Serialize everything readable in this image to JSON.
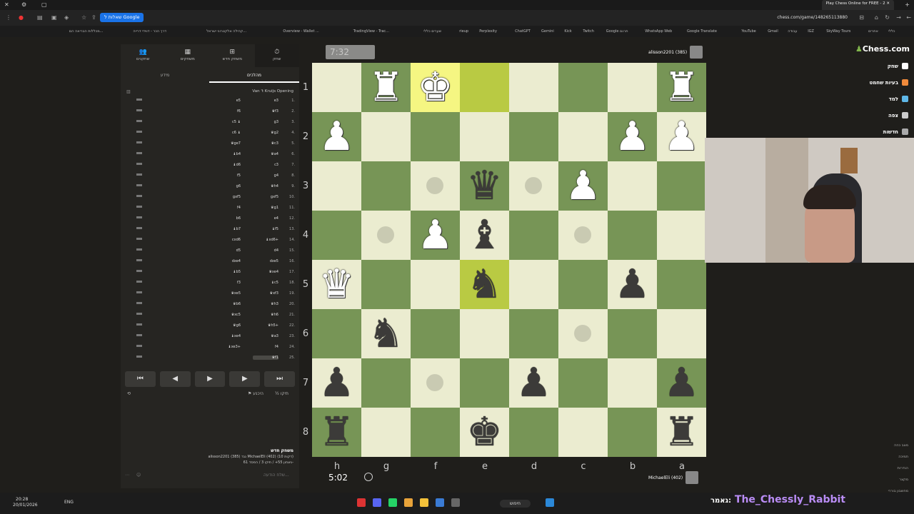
{
  "browser": {
    "tab_title": "Play Chess Online for FREE - 2",
    "google_chip": "שאלות ל Google",
    "url": "chess.com/game/148265113880"
  },
  "bookmarks": [
    "כללי",
    "אתרים",
    "SkyWay Tours",
    "IGZ",
    "עבודה",
    "Gmail",
    "YouTube",
    "Google Translate",
    "WhatsApp Web",
    "Google תרגם",
    "Twitch",
    "Kick",
    "Gemini",
    "ChatGPT",
    "Perplexity",
    "rieup",
    "שערים כללי",
    "TradingView - Trac...",
    "Overview - Wallet ...",
    "קהילה אלקטרוני ישראל...",
    "דרך הכר - דווידי דרייה",
    "מכללות הבריאה הם..."
  ],
  "right_nav": {
    "logo": "Chess",
    "logo_suffix": ".com",
    "items": [
      {
        "label": "שחק",
        "color": "#ffffff"
      },
      {
        "label": "בעיות שחמט",
        "color": "#f08a3b"
      },
      {
        "label": "למד",
        "color": "#5fb8e8"
      },
      {
        "label": "צפה",
        "color": "#cccccc"
      },
      {
        "label": "חדשות",
        "color": "#aaaaaa"
      }
    ],
    "bottom": [
      "מצב כהה",
      "תמיכה",
      "הגדרות",
      "מקצר",
      "מחשבון בוררי"
    ]
  },
  "panel": {
    "tabs": [
      {
        "label": "שחק",
        "icon": "⏱"
      },
      {
        "label": "משחק חדש",
        "icon": "⊞"
      },
      {
        "label": "משחקים",
        "icon": "▦"
      },
      {
        "label": "שחקנים",
        "icon": "👥"
      }
    ],
    "sub_tab_active": "מהלכים",
    "sub_tab_other": "מידע",
    "opening": "Van 't Kruijs Opening",
    "moves": [
      {
        "n": "1.",
        "w": "e3",
        "b": "e5"
      },
      {
        "n": "2.",
        "w": "♛f3",
        "b": "f6"
      },
      {
        "n": "3.",
        "w": "g3",
        "b": "c5 ♝"
      },
      {
        "n": "4.",
        "w": "♛g2",
        "b": "c6 ♝"
      },
      {
        "n": "5.",
        "w": "♛c3",
        "b": "♛ge7"
      },
      {
        "n": "6.",
        "w": "♛a4",
        "b": "♝b4"
      },
      {
        "n": "7.",
        "w": "c3",
        "b": "♝d6"
      },
      {
        "n": "8.",
        "w": "g4",
        "b": "f5"
      },
      {
        "n": "9.",
        "w": "♛h4",
        "b": "g6"
      },
      {
        "n": "10.",
        "w": "gxf5",
        "b": "gxf5"
      },
      {
        "n": "11.",
        "w": "♛g1",
        "b": "f4"
      },
      {
        "n": "12.",
        "w": "e4",
        "b": "b6"
      },
      {
        "n": "13.",
        "w": "♝f5",
        "b": "♝b7"
      },
      {
        "n": "14.",
        "w": "♝xd6+",
        "b": "cxd6"
      },
      {
        "n": "15.",
        "w": "d4",
        "b": "d5"
      },
      {
        "n": "16.",
        "w": "dxe5",
        "b": "dxe4"
      },
      {
        "n": "17.",
        "w": "♛xe4",
        "b": "♝b5"
      },
      {
        "n": "18.",
        "w": "♝c5",
        "b": "f3"
      },
      {
        "n": "19.",
        "w": "♛xf3",
        "b": "♛xe5"
      },
      {
        "n": "20.",
        "w": "♛h3",
        "b": "♛b6"
      },
      {
        "n": "21.",
        "w": "♛h6",
        "b": "♛xc5"
      },
      {
        "n": "22.",
        "w": "♛h5+",
        "b": "♛g6"
      },
      {
        "n": "23.",
        "w": "♛a3",
        "b": "♝xe4"
      },
      {
        "n": "24.",
        "w": "f4",
        "b": "♝xe3+"
      },
      {
        "n": "25.",
        "w": "♛f1",
        "b": ""
      }
    ],
    "controls": [
      "⏮",
      "◀",
      "▶",
      "▶",
      "⏭"
    ],
    "draw_label": "½ תיקו",
    "resign_label": "⚑ היכנע",
    "game_title": "משחק חדש",
    "game_line1": "alisson2201 (385) נגד MichaelEli (402) (10 דקות)",
    "game_line2": "ניצחון 55+ / תיקו 3 / הפסד 61-",
    "chat_placeholder": "שלח הודעה..."
  },
  "board": {
    "ranks": [
      "1",
      "2",
      "3",
      "4",
      "5",
      "6",
      "7",
      "8"
    ],
    "files": [
      "h",
      "g",
      "f",
      "e",
      "d",
      "c",
      "b",
      "a"
    ],
    "highlight": [
      [
        0,
        2
      ],
      [
        0,
        3
      ],
      [
        4,
        3
      ]
    ],
    "dots": [
      [
        2,
        2
      ],
      [
        2,
        4
      ],
      [
        3,
        1
      ],
      [
        3,
        5
      ],
      [
        5,
        5
      ],
      [
        6,
        2
      ]
    ],
    "pieces": [
      {
        "r": 0,
        "c": 1,
        "g": "♜",
        "w": true
      },
      {
        "r": 0,
        "c": 2,
        "g": "♚",
        "w": true
      },
      {
        "r": 0,
        "c": 7,
        "g": "♜",
        "w": true
      },
      {
        "r": 1,
        "c": 0,
        "g": "♟",
        "w": true
      },
      {
        "r": 1,
        "c": 6,
        "g": "♟",
        "w": true
      },
      {
        "r": 1,
        "c": 7,
        "g": "♟",
        "w": true
      },
      {
        "r": 2,
        "c": 3,
        "g": "♛",
        "w": false
      },
      {
        "r": 2,
        "c": 5,
        "g": "♟",
        "w": true
      },
      {
        "r": 3,
        "c": 2,
        "g": "♟",
        "w": true
      },
      {
        "r": 3,
        "c": 3,
        "g": "♝",
        "w": false
      },
      {
        "r": 4,
        "c": 0,
        "g": "♛",
        "w": true
      },
      {
        "r": 4,
        "c": 3,
        "g": "♞",
        "w": false
      },
      {
        "r": 4,
        "c": 6,
        "g": "♟",
        "w": false
      },
      {
        "r": 5,
        "c": 1,
        "g": "♞",
        "w": false
      },
      {
        "r": 6,
        "c": 0,
        "g": "♟",
        "w": false
      },
      {
        "r": 6,
        "c": 4,
        "g": "♟",
        "w": false
      },
      {
        "r": 6,
        "c": 7,
        "g": "♟",
        "w": false
      },
      {
        "r": 7,
        "c": 0,
        "g": "♜",
        "w": false
      },
      {
        "r": 7,
        "c": 3,
        "g": "♚",
        "w": false
      },
      {
        "r": 7,
        "c": 7,
        "g": "♜",
        "w": false
      }
    ],
    "light_color": "#ebecd0",
    "dark_color": "#779556"
  },
  "clock_top": "7:32",
  "clock_bottom": "5:02",
  "player_top": "alisson2201 (385)",
  "player_bottom": "MichaelEli (402)",
  "taskbar": {
    "time": "20:28",
    "date": "20/01/2026",
    "lang": "ENG",
    "search": "חיפוש"
  },
  "streamer": "The_Chessly_Rabbit",
  "streamer_tag": "גאמר:"
}
